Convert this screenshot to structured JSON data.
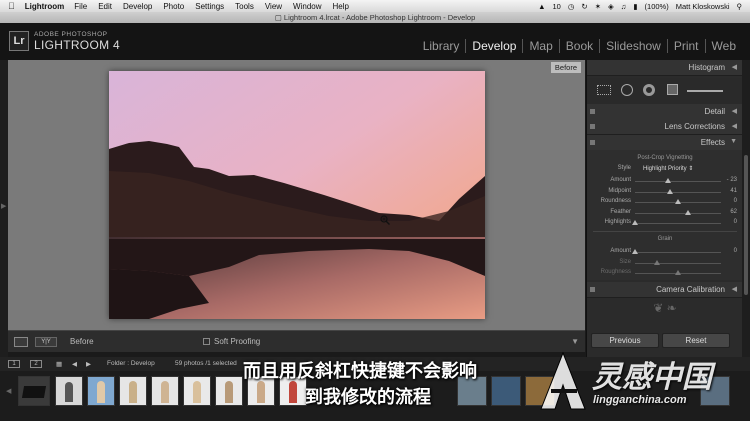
{
  "menubar": {
    "app_name": "Lightroom",
    "items": [
      "File",
      "Edit",
      "Develop",
      "Photo",
      "Settings",
      "Tools",
      "View",
      "Window",
      "Help"
    ],
    "adobe_badge": "10",
    "battery": "(100%)",
    "user": "Matt Kloskowski"
  },
  "window": {
    "title": "Lightroom 4.lrcat - Adobe Photoshop Lightroom - Develop"
  },
  "identity": {
    "badge": "Lr",
    "line1": "ADOBE PHOTOSHOP",
    "line2": "LIGHTROOM 4"
  },
  "modules": [
    "Library",
    "Develop",
    "Map",
    "Book",
    "Slideshow",
    "Print",
    "Web"
  ],
  "active_module": "Develop",
  "viewer": {
    "before_tag": "Before"
  },
  "toolbar": {
    "yy_label": "Y|Y",
    "before_label": "Before",
    "soft_proofing_label": "Soft Proofing"
  },
  "panel": {
    "histogram_title": "Histogram",
    "detail_title": "Detail",
    "lens_title": "Lens Corrections",
    "effects_title": "Effects",
    "vignette_title": "Post-Crop Vignetting",
    "style_label": "Style",
    "style_value": "Highlight Priority",
    "vignette_rows": [
      {
        "label": "Amount",
        "value": "- 23",
        "level": 0.38
      },
      {
        "label": "Midpoint",
        "value": "41",
        "level": 0.41
      },
      {
        "label": "Roundness",
        "value": "0",
        "level": 0.5
      },
      {
        "label": "Feather",
        "value": "62",
        "level": 0.62
      },
      {
        "label": "Highlights",
        "value": "0",
        "level": 0.0
      }
    ],
    "grain_title": "Grain",
    "grain_rows": [
      {
        "label": "Amount",
        "value": "0",
        "level": 0.0
      },
      {
        "label": "Size",
        "value": "",
        "level": 0.25
      },
      {
        "label": "Roughness",
        "value": "",
        "level": 0.5
      }
    ],
    "camera_title": "Camera Calibration",
    "previous_label": "Previous",
    "reset_label": "Reset"
  },
  "filmstrip_header": {
    "view1": "1",
    "view2": "2",
    "folder": "Folder : Develop",
    "count": "59 photos /1 selected"
  },
  "subtitles": {
    "line1": "而且用反斜杠快捷键不会影响",
    "line2": "到我修改的流程"
  },
  "watermark": {
    "brand": "灵感中国",
    "url": "lingganchina.com"
  },
  "colors": {
    "panel_bg": "#2b2b2b",
    "viewer_bg": "#7a7a7a",
    "active_text": "#eeeeee"
  }
}
